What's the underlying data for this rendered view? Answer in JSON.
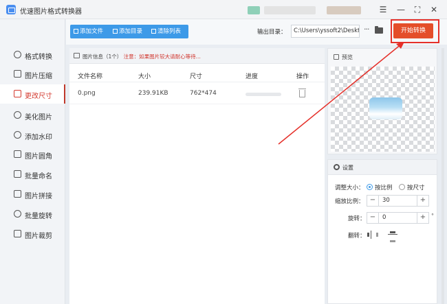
{
  "titlebar": {
    "title": "优速图片格式转换器",
    "controls": {
      "menu": "☰",
      "minimize": "—",
      "maximize": "⛶",
      "close": "✕"
    }
  },
  "sidebar": {
    "items": [
      {
        "label": "格式转换",
        "icon": "format-convert-icon"
      },
      {
        "label": "图片压缩",
        "icon": "compress-icon"
      },
      {
        "label": "更改尺寸",
        "icon": "resize-icon",
        "active": true
      },
      {
        "label": "美化图片",
        "icon": "beautify-icon"
      },
      {
        "label": "添加水印",
        "icon": "watermark-icon"
      },
      {
        "label": "图片圆角",
        "icon": "rounded-corner-icon"
      },
      {
        "label": "批量命名",
        "icon": "rename-icon"
      },
      {
        "label": "图片拼接",
        "icon": "stitch-icon"
      },
      {
        "label": "批量旋转",
        "icon": "rotate-icon"
      },
      {
        "label": "图片裁剪",
        "icon": "crop-icon"
      }
    ]
  },
  "toolbar": {
    "add_file": "添加文件",
    "add_folder": "添加目录",
    "clear_list": "清除列表",
    "output_label": "输出目录：",
    "output_path": "C:\\Users\\yssoft2\\Deskt",
    "more": "···",
    "start": "开始转换"
  },
  "file_panel": {
    "info": "图片信息（1个）",
    "note": "注意：如果图片较大请耐心等待...",
    "columns": [
      "文件名称",
      "大小",
      "尺寸",
      "进度",
      "操作"
    ],
    "rows": [
      {
        "name": "0.png",
        "size": "239.91KB",
        "dimensions": "762*474",
        "progress": 0
      }
    ]
  },
  "preview": {
    "title": "预览"
  },
  "settings": {
    "title": "设置",
    "resize_label": "调整大小：",
    "by_ratio": "按比例",
    "by_size": "按尺寸",
    "mode": "按比例",
    "scale_label": "缩放比例：",
    "scale_value": "30",
    "rotate_label": "旋转：",
    "rotate_value": "0",
    "rotate_unit": "°",
    "flip_label": "翻转：",
    "minus": "−",
    "plus": "+"
  },
  "colors": {
    "accent": "#3d9ae8",
    "start_button": "#e44e2a",
    "highlight": "#e5302a",
    "active_nav": "#d43a2f"
  }
}
